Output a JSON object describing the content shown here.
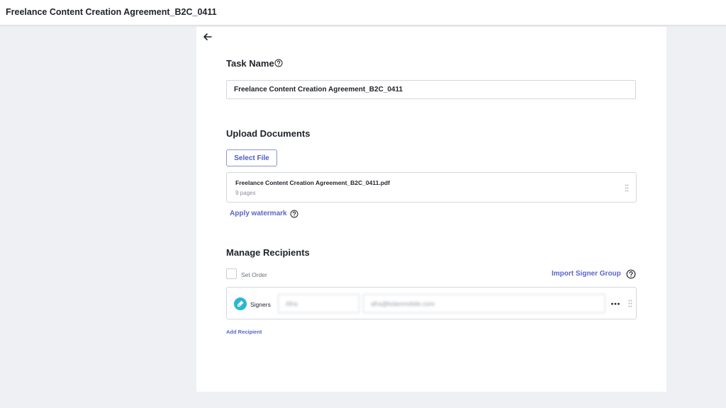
{
  "header": {
    "document_title": "Freelance Content Creation Agreement_B2C_0411"
  },
  "icons": {
    "back": "arrow-left-icon",
    "help": "question-circle-icon",
    "drag": "drag-handle-icon",
    "more": "more-horizontal-icon",
    "signer_role": "pen-nib-icon"
  },
  "colors": {
    "accent": "#5a66c9",
    "signer_badge": "#2bb6d6",
    "background": "#eef0f4"
  },
  "task": {
    "title": "Task Name",
    "value": "Freelance Content Creation Agreement_B2C_0411"
  },
  "upload": {
    "title": "Upload Documents",
    "select_file_label": "Select File",
    "document": {
      "file_name": "Freelance Content Creation Agreement_B2C_0411.pdf",
      "pages": "9 pages"
    },
    "watermark_label": "Apply watermark"
  },
  "recipients": {
    "title": "Manage Recipients",
    "set_order_label": "Set Order",
    "import_label": "Import Signer Group",
    "rows": [
      {
        "role": "Signers",
        "name": "Afra",
        "email": "afra@kdanmobile.com"
      }
    ],
    "add_label": "Add Recipient"
  }
}
